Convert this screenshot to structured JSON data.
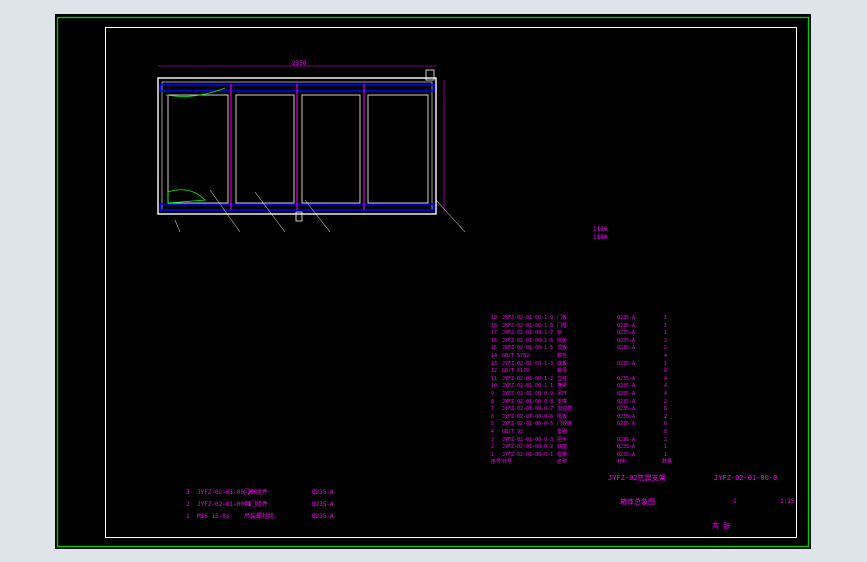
{
  "colors": {
    "background": "#dfe3ea",
    "canvas": "#000000",
    "border_green": "#00d000",
    "border_white": "#ffffff",
    "frame_white": "#ffffff",
    "blue": "#0000ff",
    "magenta": "#ff00ff",
    "green_fill": "#00ff00",
    "yellow": "#ffff00",
    "red": "#ff0000"
  },
  "views": {
    "front": {
      "dimension": "2350"
    },
    "side": {
      "dimension_upper": "1100",
      "dimension_lower": "1180"
    },
    "top": {}
  },
  "front_callouts": [
    "1",
    "2",
    "3",
    "4",
    "5",
    "6",
    "7",
    "8",
    "9",
    "10",
    "11",
    "12",
    "13",
    "14"
  ],
  "side_callouts": [
    "1",
    "2",
    "3",
    "4",
    "5",
    "6"
  ],
  "bom": {
    "rows": [
      {
        "no": "19",
        "code": "JYFZ-02-01-00-1-9",
        "name": "门板",
        "material": "Q235-A",
        "qty": "1"
      },
      {
        "no": "18",
        "code": "JYFZ-02-01-00-1-8",
        "name": "门框",
        "material": "Q235-A",
        "qty": "1"
      },
      {
        "no": "17",
        "code": "JYFZ-02-01-00-1-7",
        "name": "锁",
        "material": "Q235-A",
        "qty": "1"
      },
      {
        "no": "16",
        "code": "JYFZ-02-01-00-1-6",
        "name": "侧板",
        "material": "Q235-A",
        "qty": "2"
      },
      {
        "no": "15",
        "code": "JYFZ-02-01-00-1-5",
        "name": "顶板",
        "material": "Q235-A",
        "qty": "2"
      },
      {
        "no": "14",
        "code": "GB/T 5782",
        "name": "螺栓",
        "material": "",
        "qty": "4"
      },
      {
        "no": "13",
        "code": "JYFZ-02-01-00-1-3",
        "name": "底板",
        "material": "Q235-A",
        "qty": "1"
      },
      {
        "no": "12",
        "code": "GB/T 6170",
        "name": "螺母",
        "material": "",
        "qty": "8"
      },
      {
        "no": "11",
        "code": "JYFZ-02-01-00-1-2",
        "name": "立柱",
        "material": "Q235-A",
        "qty": "4"
      },
      {
        "no": "10",
        "code": "JYFZ-02-01-00-1-1",
        "name": "横梁",
        "material": "Q235-A",
        "qty": "4"
      },
      {
        "no": "9",
        "code": "JYFZ-02-01-00-0-9",
        "name": "吊环",
        "material": "Q235-A",
        "qty": "4"
      },
      {
        "no": "8",
        "code": "JYFZ-02-01-00-0-8",
        "name": "支撑",
        "material": "Q235-A",
        "qty": "2"
      },
      {
        "no": "7",
        "code": "JYFZ-02-01-00-0-7",
        "name": "加强筋",
        "material": "Q235-A",
        "qty": "6"
      },
      {
        "no": "6",
        "code": "JYFZ-02-01-00-0-6",
        "name": "隔板",
        "material": "Q235-A",
        "qty": "2"
      },
      {
        "no": "5",
        "code": "JYFZ-02-01-00-0-5",
        "name": "门铰链",
        "material": "Q235-A",
        "qty": "6"
      },
      {
        "no": "4",
        "code": "GB/T 93",
        "name": "垫圈",
        "material": "",
        "qty": "8"
      },
      {
        "no": "3",
        "code": "JYFZ-02-01-00-0-3",
        "name": "把手",
        "material": "Q235-A",
        "qty": "2"
      },
      {
        "no": "2",
        "code": "JYFZ-02-01-00-0-2",
        "name": "底座",
        "material": "Q235-A",
        "qty": "1"
      },
      {
        "no": "1",
        "code": "JYFZ-02-01-00-0-1",
        "name": "框架",
        "material": "Q235-A",
        "qty": "1"
      }
    ],
    "header": {
      "no": "序号",
      "code": "代号",
      "name": "名称",
      "qty": "数量",
      "material": "材料"
    }
  },
  "title_block": {
    "project": "JYFZ-02抗震支架",
    "drawing_no": "JYFZ-02-01-00-0",
    "name": "箱体总装图",
    "scale": "1:15",
    "sheet": "1",
    "unit": "共 张",
    "company": "",
    "labels": [
      "设计",
      "审核",
      "工艺",
      "标准化",
      "批准",
      "日期",
      "比例",
      "重量",
      "阶段标记"
    ]
  },
  "left_table": {
    "rows": [
      {
        "no": "3",
        "code": "JYFZ-02-01-00-2",
        "name": "门框组件",
        "material": "Q235-A"
      },
      {
        "no": "2",
        "code": "JYFZ-02-01-00-1",
        "name": "侧门组件",
        "material": "Q235-A"
      },
      {
        "no": "1",
        "code": "M16 15-8s",
        "name": "吊装螺栓组",
        "material": "Q235-A"
      }
    ]
  }
}
